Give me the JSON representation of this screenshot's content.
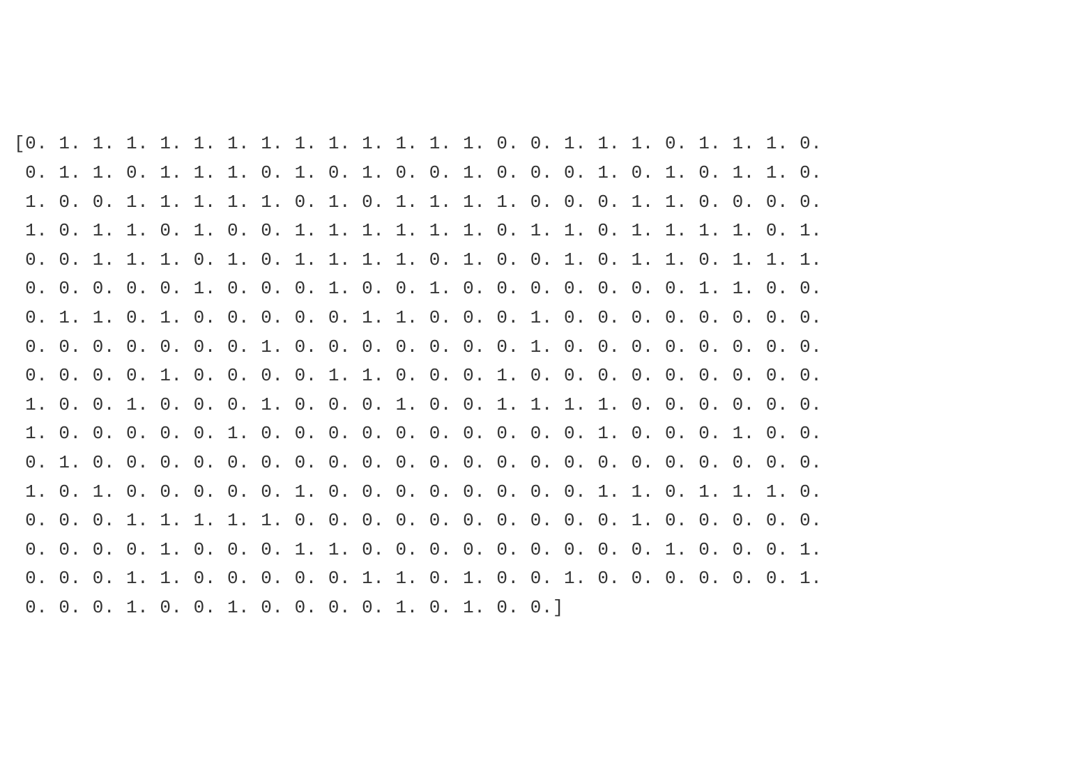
{
  "array_data": {
    "rows": [
      [
        0,
        1,
        1,
        1,
        1,
        1,
        1,
        1,
        1,
        1,
        1,
        1,
        1,
        1,
        0,
        0,
        1,
        1,
        1,
        0,
        1,
        1,
        1,
        0
      ],
      [
        0,
        1,
        1,
        0,
        1,
        1,
        1,
        0,
        1,
        0,
        1,
        0,
        0,
        1,
        0,
        0,
        0,
        1,
        0,
        1,
        0,
        1,
        1,
        0
      ],
      [
        1,
        0,
        0,
        1,
        1,
        1,
        1,
        1,
        0,
        1,
        0,
        1,
        1,
        1,
        1,
        0,
        0,
        0,
        1,
        1,
        0,
        0,
        0,
        0
      ],
      [
        1,
        0,
        1,
        1,
        0,
        1,
        0,
        0,
        1,
        1,
        1,
        1,
        1,
        1,
        0,
        1,
        1,
        0,
        1,
        1,
        1,
        1,
        0,
        1
      ],
      [
        0,
        0,
        1,
        1,
        1,
        0,
        1,
        0,
        1,
        1,
        1,
        1,
        0,
        1,
        0,
        0,
        1,
        0,
        1,
        1,
        0,
        1,
        1,
        1
      ],
      [
        0,
        0,
        0,
        0,
        0,
        1,
        0,
        0,
        0,
        1,
        0,
        0,
        1,
        0,
        0,
        0,
        0,
        0,
        0,
        0,
        1,
        1,
        0,
        0
      ],
      [
        0,
        1,
        1,
        0,
        1,
        0,
        0,
        0,
        0,
        0,
        1,
        1,
        0,
        0,
        0,
        1,
        0,
        0,
        0,
        0,
        0,
        0,
        0,
        0
      ],
      [
        0,
        0,
        0,
        0,
        0,
        0,
        0,
        1,
        0,
        0,
        0,
        0,
        0,
        0,
        0,
        1,
        0,
        0,
        0,
        0,
        0,
        0,
        0,
        0
      ],
      [
        0,
        0,
        0,
        0,
        1,
        0,
        0,
        0,
        0,
        1,
        1,
        0,
        0,
        0,
        1,
        0,
        0,
        0,
        0,
        0,
        0,
        0,
        0,
        0
      ],
      [
        1,
        0,
        0,
        1,
        0,
        0,
        0,
        1,
        0,
        0,
        0,
        1,
        0,
        0,
        1,
        1,
        1,
        1,
        0,
        0,
        0,
        0,
        0,
        0
      ],
      [
        1,
        0,
        0,
        0,
        0,
        0,
        1,
        0,
        0,
        0,
        0,
        0,
        0,
        0,
        0,
        0,
        0,
        1,
        0,
        0,
        0,
        1,
        0,
        0
      ],
      [
        0,
        1,
        0,
        0,
        0,
        0,
        0,
        0,
        0,
        0,
        0,
        0,
        0,
        0,
        0,
        0,
        0,
        0,
        0,
        0,
        0,
        0,
        0,
        0
      ],
      [
        1,
        0,
        1,
        0,
        0,
        0,
        0,
        0,
        1,
        0,
        0,
        0,
        0,
        0,
        0,
        0,
        0,
        1,
        1,
        0,
        1,
        1,
        1,
        0
      ],
      [
        0,
        0,
        0,
        1,
        1,
        1,
        1,
        1,
        0,
        0,
        0,
        0,
        0,
        0,
        0,
        0,
        0,
        0,
        1,
        0,
        0,
        0,
        0,
        0
      ],
      [
        0,
        0,
        0,
        0,
        1,
        0,
        0,
        0,
        1,
        1,
        0,
        0,
        0,
        0,
        0,
        0,
        0,
        0,
        0,
        1,
        0,
        0,
        0,
        1
      ],
      [
        0,
        0,
        0,
        1,
        1,
        0,
        0,
        0,
        0,
        0,
        1,
        1,
        0,
        1,
        0,
        0,
        1,
        0,
        0,
        0,
        0,
        0,
        0,
        1
      ],
      [
        0,
        0,
        0,
        1,
        0,
        0,
        1,
        0,
        0,
        0,
        0,
        1,
        0,
        1,
        0,
        0
      ]
    ],
    "open_bracket": "[",
    "close_bracket": "]",
    "indent": " "
  }
}
